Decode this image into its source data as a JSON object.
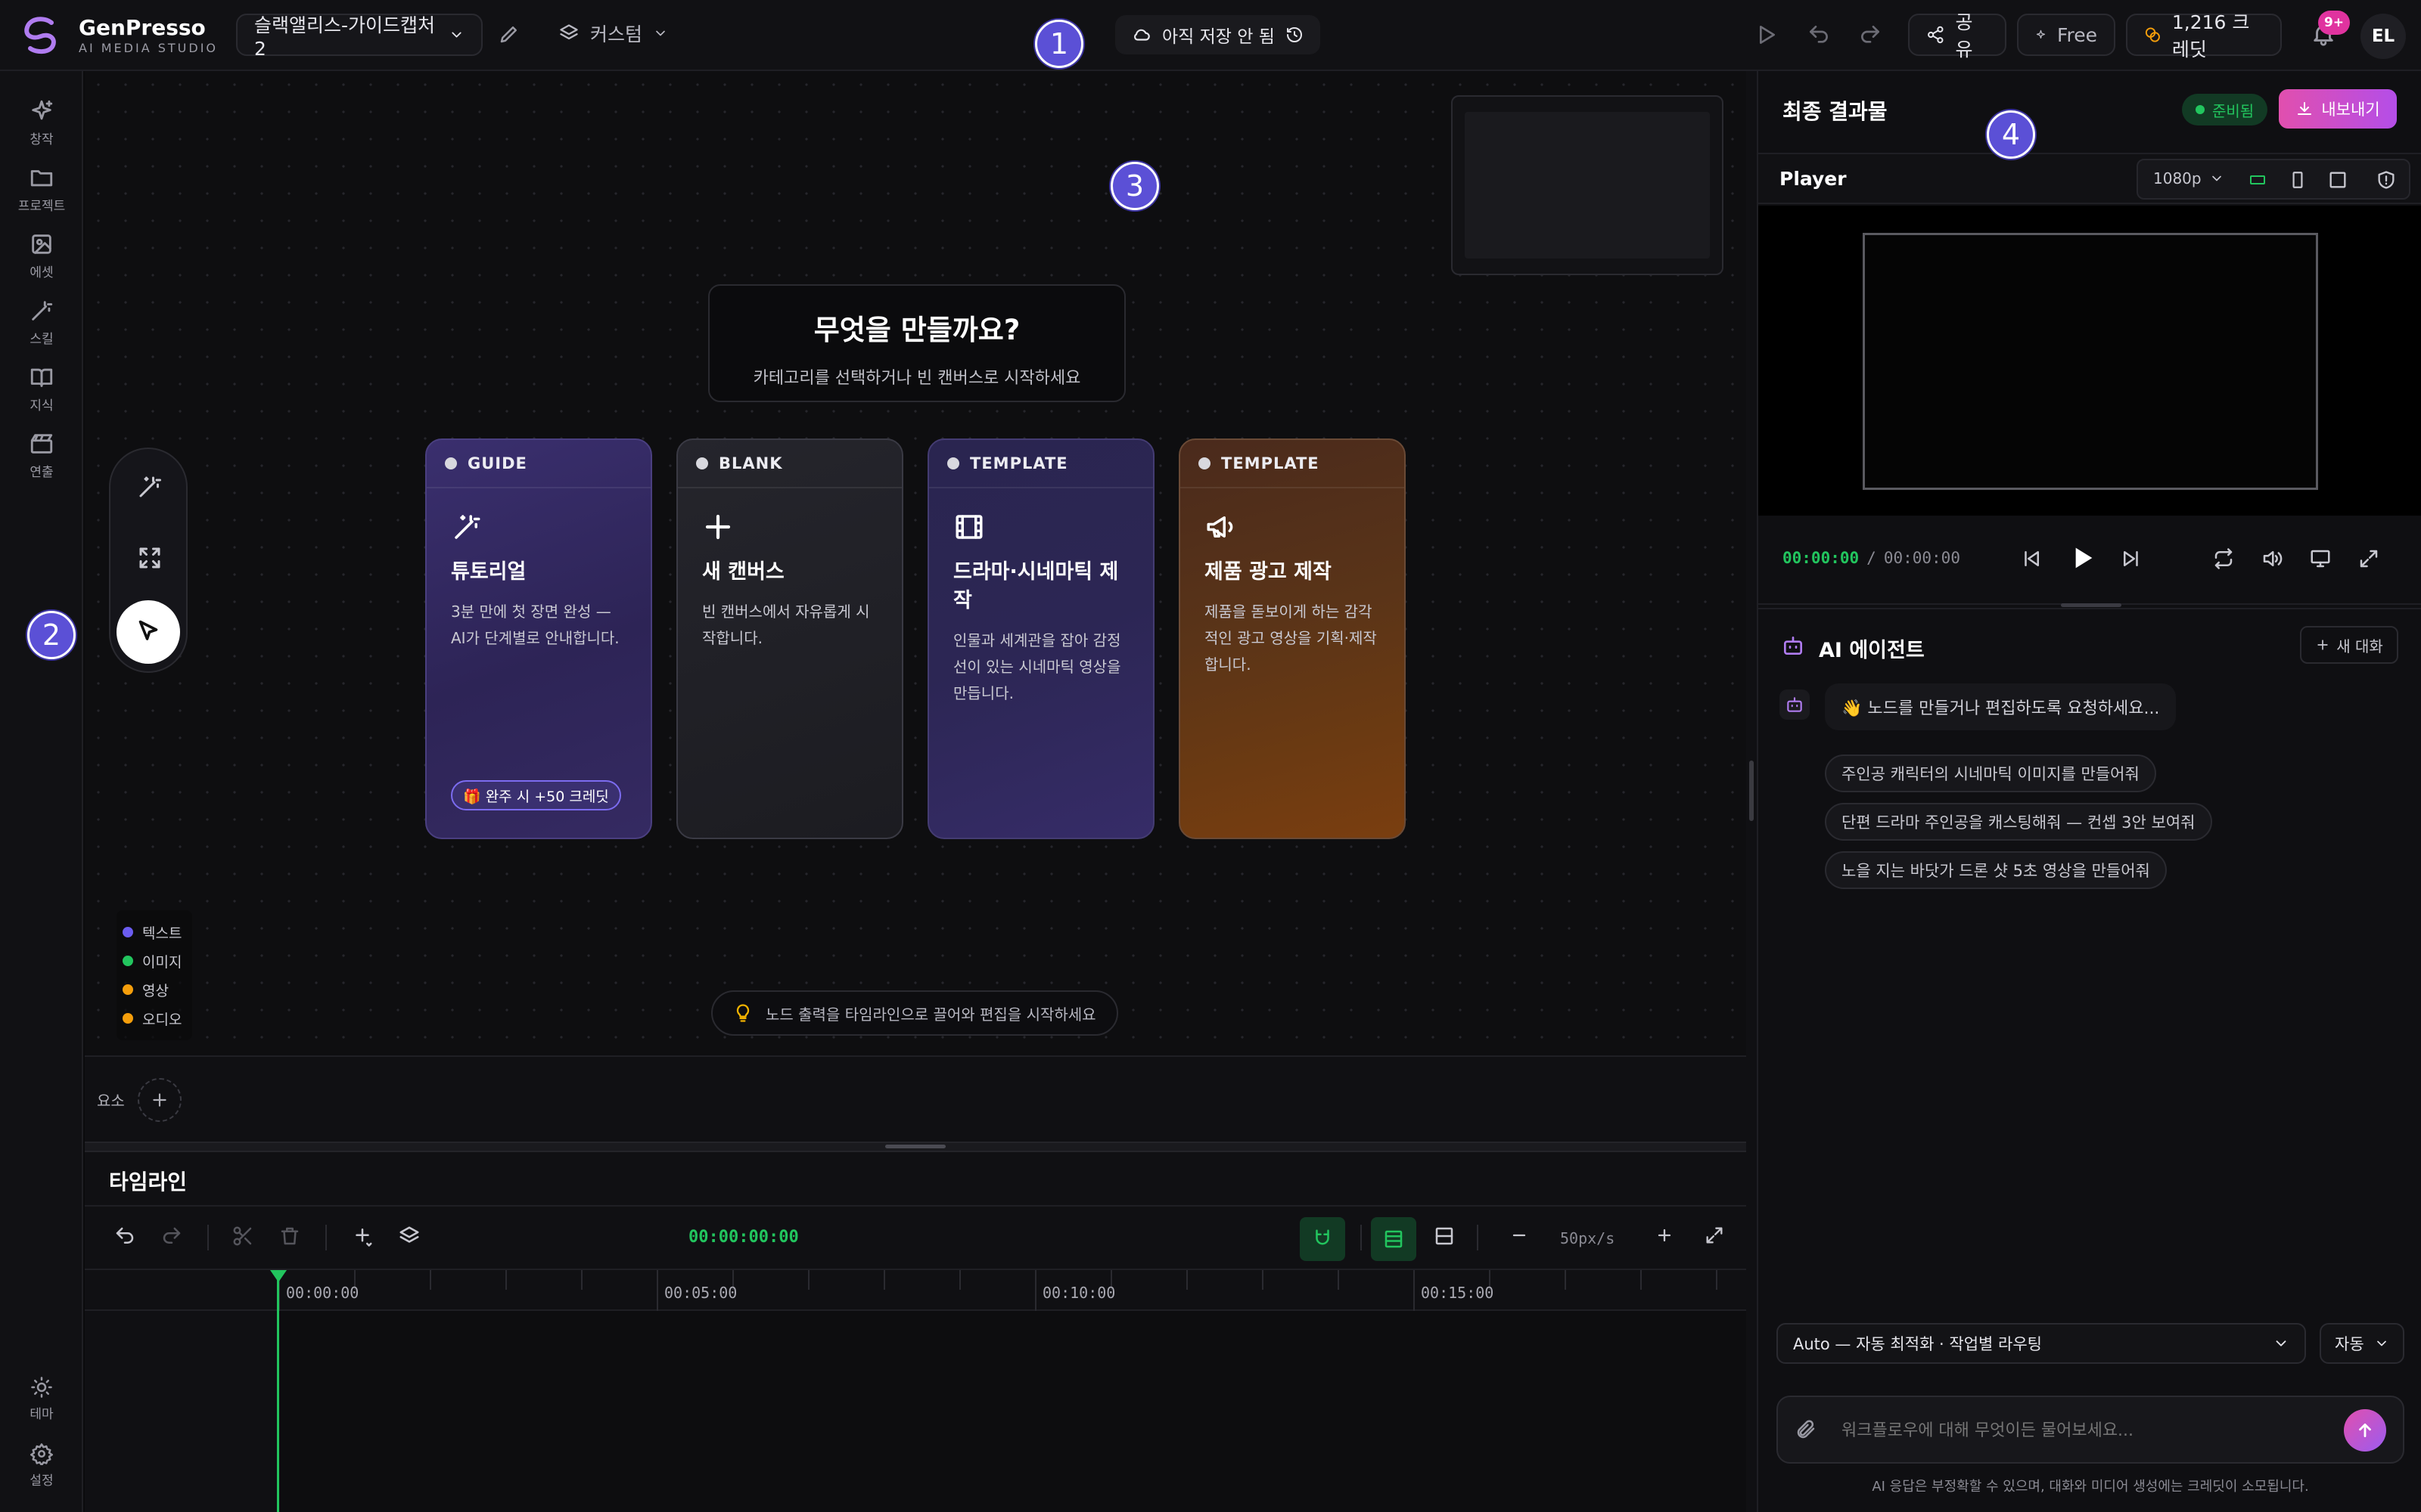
{
  "brand": {
    "name": "GenPresso",
    "tagline": "AI MEDIA STUDIO"
  },
  "header": {
    "project_name": "슬랙앨리스-가이드캡처2",
    "mode_label": "커스텀",
    "save_status": "아직 저장 안 됨",
    "share_label": "공유",
    "plan_label": "Free",
    "credits_label": "1,216 크레딧",
    "notif_badge": "9+",
    "avatar_initials": "EL"
  },
  "markers": [
    "1",
    "2",
    "3",
    "4"
  ],
  "sidebar": {
    "items": [
      {
        "label": "창작",
        "icon": "sparkle-icon"
      },
      {
        "label": "프로젝트",
        "icon": "folder-icon"
      },
      {
        "label": "에셋",
        "icon": "image-icon"
      },
      {
        "label": "스킬",
        "icon": "wand-icon"
      },
      {
        "label": "지식",
        "icon": "book-icon"
      },
      {
        "label": "연출",
        "icon": "clapper-icon"
      }
    ],
    "bottom": [
      {
        "label": "테마",
        "icon": "sun-icon"
      },
      {
        "label": "설정",
        "icon": "gear-icon"
      }
    ]
  },
  "canvas": {
    "hero_title": "무엇을 만들까요?",
    "hero_subtitle": "카테고리를 선택하거나 빈 캔버스로 시작하세요",
    "cards": [
      {
        "tag": "GUIDE",
        "title": "튜토리얼",
        "desc": "3분 만에 첫 장면 완성 — AI가 단계별로 안내합니다.",
        "badge": "🎁 완주 시 +50 크레딧"
      },
      {
        "tag": "BLANK",
        "title": "새 캔버스",
        "desc": "빈 캔버스에서 자유롭게 시작합니다."
      },
      {
        "tag": "TEMPLATE",
        "title": "드라마·시네마틱 제작",
        "desc": "인물과 세계관을 잡아 감정선이 있는 시네마틱 영상을 만듭니다."
      },
      {
        "tag": "TEMPLATE",
        "title": "제품 광고 제작",
        "desc": "제품을 돋보이게 하는 감각적인 광고 영상을 기획·제작합니다."
      }
    ],
    "legend": [
      {
        "label": "텍스트",
        "color": "#6b5cf0"
      },
      {
        "label": "이미지",
        "color": "#22c55e"
      },
      {
        "label": "영상",
        "color": "#f59e0b"
      },
      {
        "label": "오디오",
        "color": "#f59e0b"
      }
    ],
    "hint": "노드 출력을 타임라인으로 끌어와 편집을 시작하세요"
  },
  "elements": {
    "label": "요소"
  },
  "timeline": {
    "title": "타임라인",
    "timecode": "00:00:00:00",
    "zoom": "50px/s",
    "ticks": [
      "00:00:00",
      "00:05:00",
      "00:10:00",
      "00:15:00"
    ]
  },
  "result": {
    "title": "최종 결과물",
    "status": "준비됨",
    "export_label": "내보내기",
    "player_label": "Player",
    "resolution": "1080p",
    "time_current": "00:00:00",
    "time_separator": "/",
    "time_total": "00:00:00"
  },
  "agent": {
    "title": "AI 에이전트",
    "new_chat": "새 대화",
    "greeting": "👋 노드를 만들거나 편집하도록 요청하세요...",
    "suggestions": [
      "주인공 캐릭터의 시네마틱 이미지를 만들어줘",
      "단편 드라마 주인공을 캐스팅해줘 — 컨셉 3안 보여줘",
      "노을 지는 바닷가 드론 샷 5초 영상을 만들어줘"
    ],
    "model_select": "Auto — 자동 최적화 · 작업별 라우팅",
    "mode_select": "자동",
    "input_placeholder": "워크플로우에 대해 무엇이든 물어보세요...",
    "disclaimer": "AI 응답은 부정확할 수 있으며, 대화와 미디어 생성에는 크레딧이 소모됩니다."
  },
  "colors": {
    "accent": "#7c6cf0",
    "success": "#22c55e",
    "export": "#d946ef",
    "timecode": "#22c55e"
  }
}
